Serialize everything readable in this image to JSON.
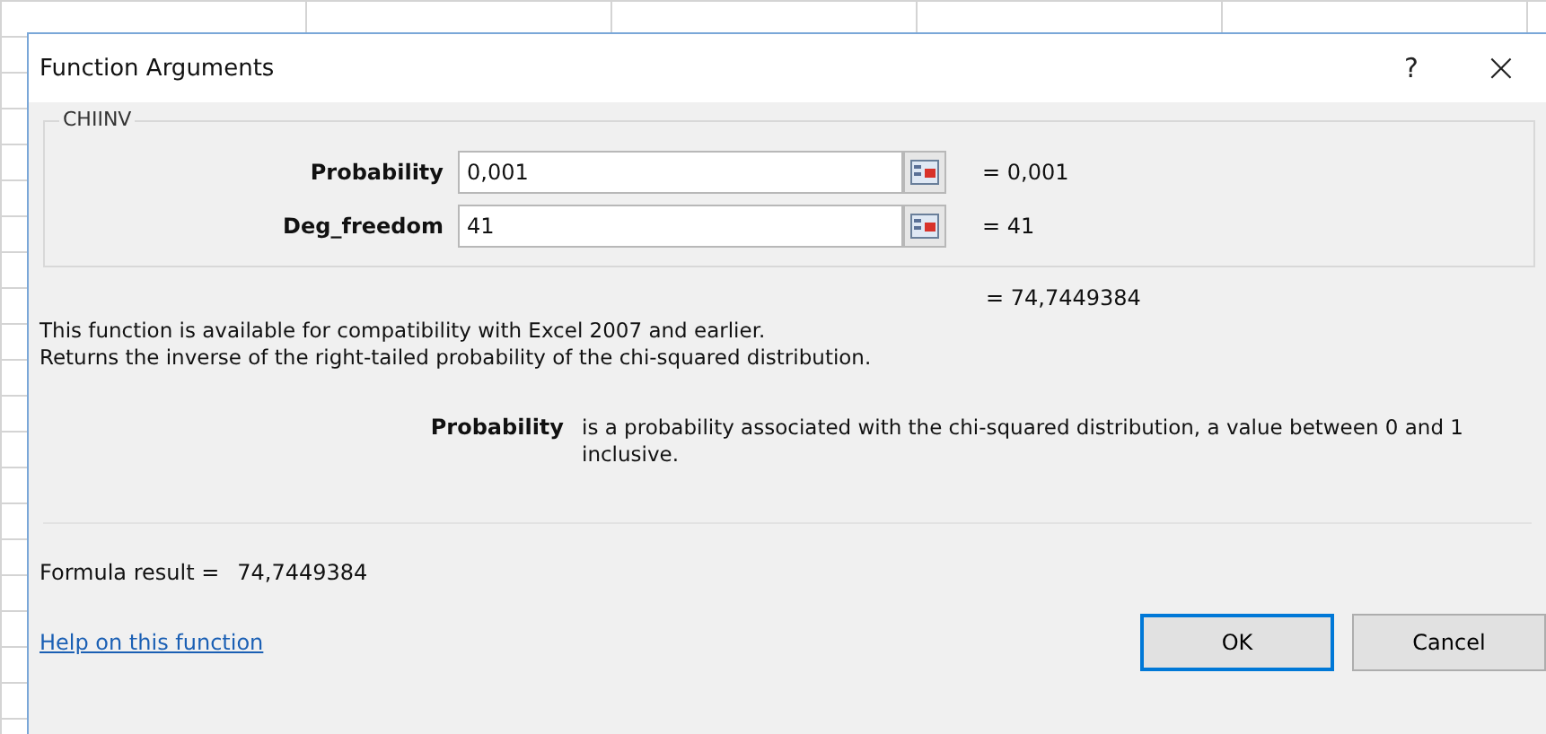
{
  "window": {
    "title": "Function Arguments",
    "help": "?",
    "close": "×"
  },
  "function_name": "CHIINV",
  "arguments": [
    {
      "label": "Probability",
      "value": "0,001",
      "result": "= 0,001"
    },
    {
      "label": "Deg_freedom",
      "value": "41",
      "result": "= 41"
    }
  ],
  "overall_result": "= 74,7449384",
  "description": [
    "This function is available for compatibility with Excel 2007 and earlier.",
    "Returns the inverse of the right-tailed probability of the chi-squared distribution."
  ],
  "argument_help": {
    "label": "Probability",
    "text": "is a probability associated with the chi-squared distribution, a value between 0 and 1 inclusive."
  },
  "formula_result": {
    "label": "Formula result =",
    "value": "74,7449384"
  },
  "help_link": "Help on this function",
  "buttons": [
    {
      "label": "OK",
      "default": true
    },
    {
      "label": "Cancel",
      "default": false
    }
  ]
}
